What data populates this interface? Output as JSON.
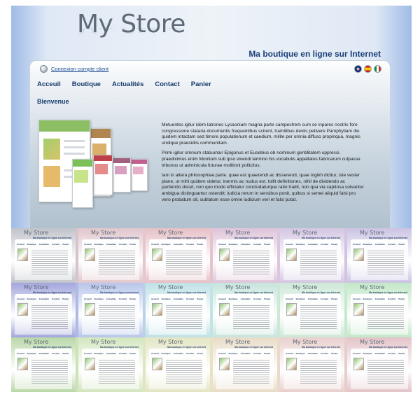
{
  "store": {
    "name": "My Store",
    "tagline": "Ma boutique en ligne sur Internet"
  },
  "account": {
    "icon": "user-icon",
    "link_label": "Connexion compte client"
  },
  "languages": [
    {
      "name": "english-flag-icon",
      "color": "#012169"
    },
    {
      "name": "spanish-flag-icon",
      "color": "#c60b1e"
    },
    {
      "name": "italian-flag-icon",
      "color": "#009246"
    }
  ],
  "nav": {
    "items": [
      "Acceuil",
      "Boutique",
      "Actualités",
      "Contact",
      "Panier"
    ]
  },
  "content": {
    "heading": "Bienvenue",
    "paragraphs": [
      "Metuentes igitur idem latrones Lycaoniam magna parte campestrem cum se inpares nostris fore congressione stataria documentis frequentibus scirent, tramitibus deviis petivere Pamphyliam diu quidem intactam sed timore populationum et caedium, milite per omnia diffuso propinqua, magnis undique praesidiis communitam.",
      "Primi igitur omnium statuuntur Epigonus et Eusebius ob nominum gentilitatem oppressi. praediximus enim Montium sub ipso vivendi termino his vocabulis appellatos fabricarum culpasse tribunos ut adminicula futurae molitioni pollicitos.",
      "Iam in altera philosophiae parte. quae est quaerendi ac disserendi, quae logikh dicitur, iste vester plane, ut mihi quidem videtur, inermis ac nudus est. tollit definitiones, nihil de dividendo ac partiendo docet, non quo modo efficiatur concludaturque ratio tradit, non qua via captiosa solvantur ambigua distinguantur ostendit; iudicia rerum in sensibus ponit, quibus si semel aliquid falsi pro vero probatum sit, sublatum esse omne iudicium veri et falsi putat."
    ]
  },
  "colors": {
    "brand_blue": "#183f78",
    "nav_text": "#163a6c",
    "link": "#1e4f97"
  },
  "variants": {
    "rows": 3,
    "per_row": 6,
    "themes": [
      [
        "#c0c3ca",
        "#e0c6cc",
        "#e6c0c6",
        "#dec3d9",
        "#d4c6e2",
        "#cbc3e3"
      ],
      [
        "#a2a6dc",
        "#b7c5ea",
        "#bfe1e6",
        "#c6e4dc",
        "#cde8d6",
        "#c2e7c8"
      ],
      [
        "#b9d8a8",
        "#d3e6bf",
        "#e3e5c3",
        "#e9dcc8",
        "#e9d0cd",
        "#e3c3c8"
      ]
    ]
  }
}
